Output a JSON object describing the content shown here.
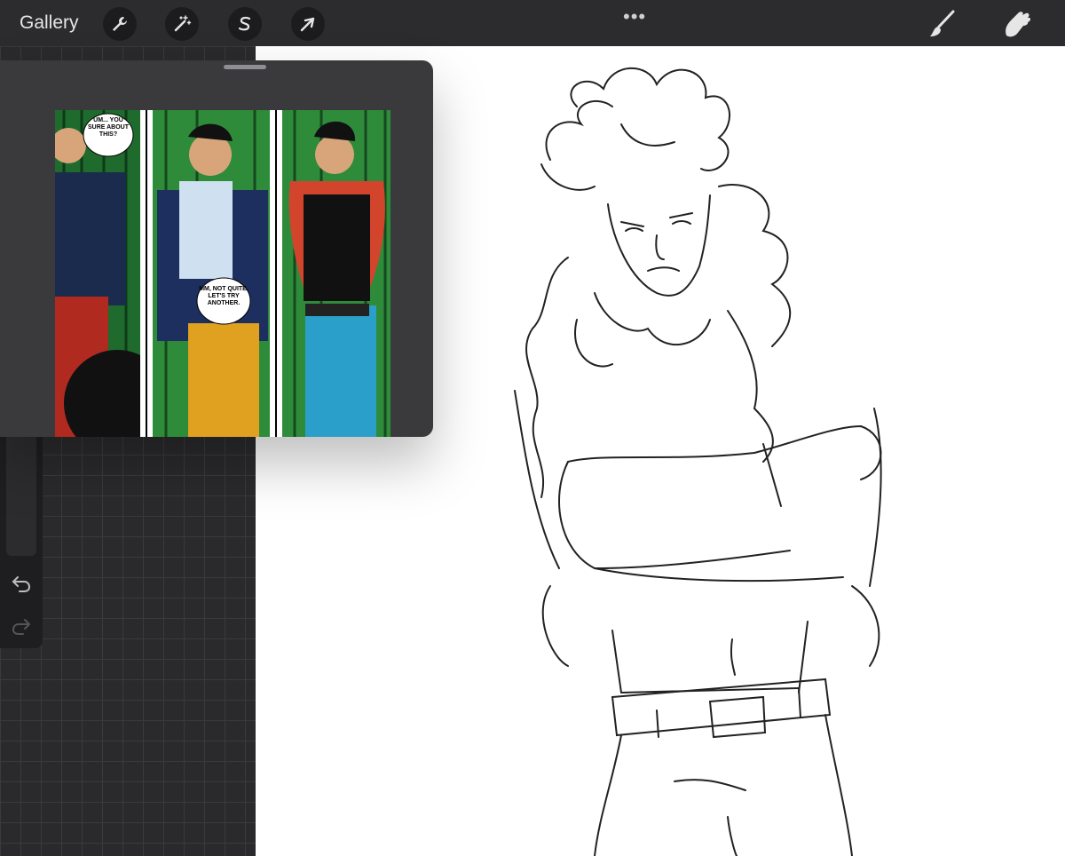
{
  "topbar": {
    "gallery_label": "Gallery",
    "dots": "•••",
    "left_tools": [
      {
        "name": "actions",
        "icon": "wrench-icon"
      },
      {
        "name": "adjustments",
        "icon": "magic-wand-icon"
      },
      {
        "name": "selection",
        "icon": "selection-s-icon"
      },
      {
        "name": "transform",
        "icon": "arrow-cursor-icon"
      }
    ],
    "right_tools": [
      {
        "name": "brush",
        "icon": "brush-icon"
      },
      {
        "name": "smudge",
        "icon": "smudge-finger-icon"
      }
    ]
  },
  "sidebar": {
    "brush_size_level": 0.5,
    "opacity_level": 0.05,
    "modify_button_icon": "square-icon",
    "undo_icon": "undo-icon",
    "redo_icon": "redo-icon"
  },
  "reference": {
    "panel1_bubble": "UM... YOU SURE ABOUT THIS?",
    "panel2_bubble": "MM, NOT QUITE. LET'S TRY ANOTHER."
  },
  "colors": {
    "toolbar_bg": "#2c2c2e",
    "canvas_bg": "#ffffff",
    "curtain_green": "#2e8b3a"
  }
}
